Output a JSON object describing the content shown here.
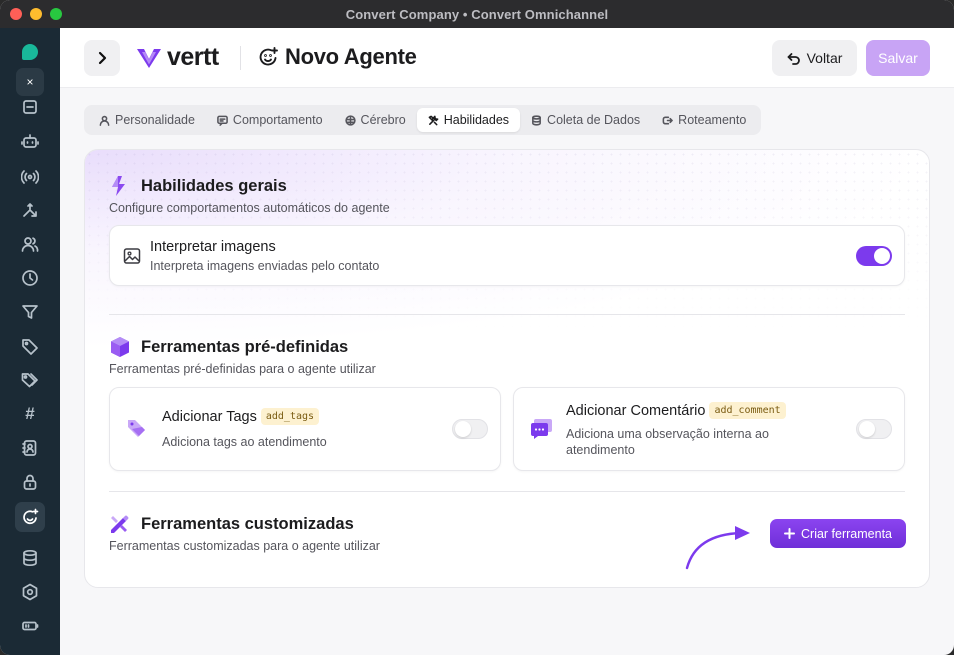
{
  "window": {
    "title": "Convert Company • Convert Omnichannel"
  },
  "sidebar": {
    "close_label": "×",
    "hash_glyph": "#"
  },
  "header": {
    "brand": "vertt",
    "agent_title": "Novo Agente",
    "back_label": "Voltar",
    "save_label": "Salvar"
  },
  "tabs": [
    {
      "label": "Personalidade",
      "icon": "user-icon",
      "active": false
    },
    {
      "label": "Comportamento",
      "icon": "message-icon",
      "active": false
    },
    {
      "label": "Cérebro",
      "icon": "brain-icon",
      "active": false
    },
    {
      "label": "Habilidades",
      "icon": "tools-icon",
      "active": true
    },
    {
      "label": "Coleta de Dados",
      "icon": "database-icon",
      "active": false
    },
    {
      "label": "Roteamento",
      "icon": "route-icon",
      "active": false
    }
  ],
  "sections": {
    "general": {
      "title": "Habilidades gerais",
      "subtitle": "Configure comportamentos automáticos do agente",
      "option": {
        "title": "Interpretar imagens",
        "subtitle": "Interpreta imagens enviadas pelo contato",
        "enabled": true
      }
    },
    "predefined": {
      "title": "Ferramentas pré-definidas",
      "subtitle": "Ferramentas pré-definidas para o agente utilizar",
      "tools": [
        {
          "title": "Adicionar Tags",
          "code": "add_tags",
          "subtitle": "Adiciona tags ao atendimento",
          "enabled": false
        },
        {
          "title": "Adicionar Comentário",
          "code": "add_comment",
          "subtitle": "Adiciona uma observação interna ao atendimento",
          "enabled": false
        }
      ]
    },
    "custom": {
      "title": "Ferramentas customizadas",
      "subtitle": "Ferramentas customizadas para o agente utilizar",
      "create_label": "Criar ferramenta"
    }
  },
  "colors": {
    "accent": "#7c3aed",
    "save_disabled": "#c8a4f5",
    "sidebar_bg": "#1b2a35",
    "code_badge_bg": "#fdf1d0"
  }
}
